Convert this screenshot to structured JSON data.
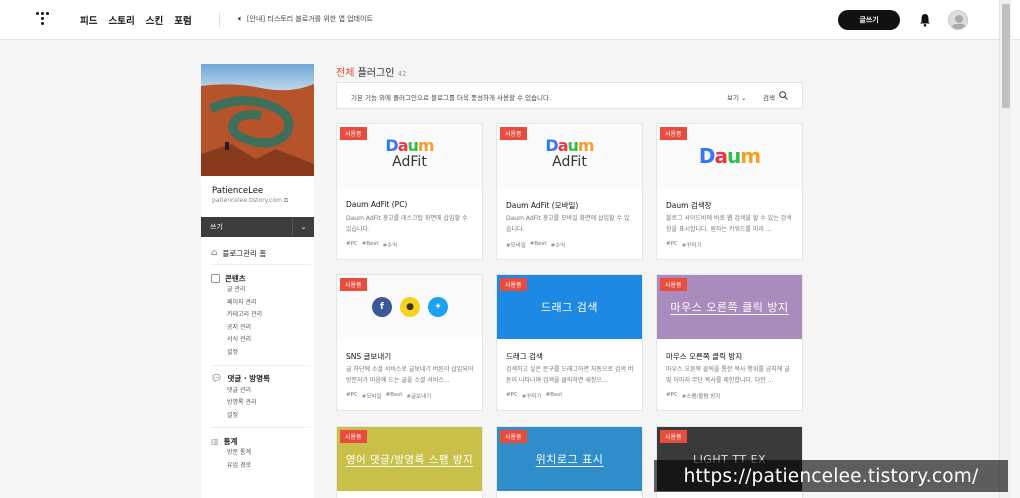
{
  "header": {
    "nav": [
      "피드",
      "스토리",
      "스킨",
      "포럼"
    ],
    "notice": "[안내] 티스토리 블로거를 위한 앱 업데이트",
    "write_button": "글쓰기"
  },
  "sidebar": {
    "name": "PatienceLee",
    "url": "patiencelee.tistory.com",
    "write": "쓰기",
    "home": "블로그관리 홈",
    "sections": [
      {
        "title": "콘텐츠",
        "items": [
          "글 관리",
          "페이지 관리",
          "카테고리 관리",
          "공지 관리",
          "서식 관리",
          "설정"
        ]
      },
      {
        "title": "댓글 · 방명록",
        "items": [
          "댓글 관리",
          "방명록 관리",
          "설정"
        ]
      },
      {
        "title": "통계",
        "items": [
          "방문 통계",
          "유입 경로"
        ]
      }
    ]
  },
  "main": {
    "title_red": "전체",
    "title": "플러그인",
    "count": "42",
    "info": "기본 기능 외에 플러그인으로 블로그를 더욱 풍성하게 사용할 수 있습니다.",
    "view": "보기",
    "search": "검색"
  },
  "badge": "사용중",
  "cards": [
    {
      "name": "Daum AdFit (PC)",
      "desc": "Daum AdFit 광고를 데스크탑 화면에 삽입할 수 있습니다.",
      "tags": [
        "#PC",
        "#Best",
        "#수익"
      ],
      "thumb_logo": "Daum",
      "thumb_sub": "AdFit"
    },
    {
      "name": "Daum AdFit (모바일)",
      "desc": "Daum AdFit 광고를 모바일 화면에 삽입할 수 있습니다.",
      "tags": [
        "#모바일",
        "#Best",
        "#수익"
      ],
      "thumb_logo": "Daum",
      "thumb_sub": "AdFit"
    },
    {
      "name": "Daum 검색창",
      "desc": "블로그 사이드바에 바로 웹 검색을 할 수 있는 검색창을 표시합니다. 원하는 키워드를 미리 …",
      "tags": [
        "#PC",
        "#꾸미기"
      ],
      "thumb_logo": "Daum"
    },
    {
      "name": "SNS 글보내기",
      "desc": "글 하단에 소셜 서비스로 글보내기 버튼이 삽입되어 방문자가 마음에 드는 글을 소셜 서비스…",
      "tags": [
        "#PC",
        "#모바일",
        "#Best",
        "#글보내기"
      ]
    },
    {
      "name": "드래그 검색",
      "desc": "검색하고 싶은 문구를 드래그하면 자동으로 검색 버튼이 나타나며 검색을 클릭하면 새창으…",
      "tags": [
        "#PC",
        "#꾸미기",
        "#Best"
      ],
      "thumb_text": "드래그 검색"
    },
    {
      "name": "마우스 오른쪽 클릭 방지",
      "desc": "마우스 오른쪽 클릭을 통한 복사 행위를 금지해 글 및 이미지 무단 복사를 제한합니다. 다만 …",
      "tags": [
        "#PC",
        "#스팸/불펌 방지"
      ],
      "thumb_text": "마우스 오른쪽 클릭 방지"
    },
    {
      "thumb_text": "영어 댓글/방명록 스팸 방지"
    },
    {
      "thumb_text": "위치로그 표시"
    },
    {
      "thumb_text": "LIGHT TT EX"
    }
  ],
  "watermark": "https://patiencelee.tistory.com/",
  "colors": {
    "accent": "#e84c3d",
    "drag_blue": "#1e88e5",
    "purple": "#a98bbd",
    "olive": "#c9c04a",
    "teal": "#2f8ec9",
    "dark": "#3a3a3a"
  }
}
